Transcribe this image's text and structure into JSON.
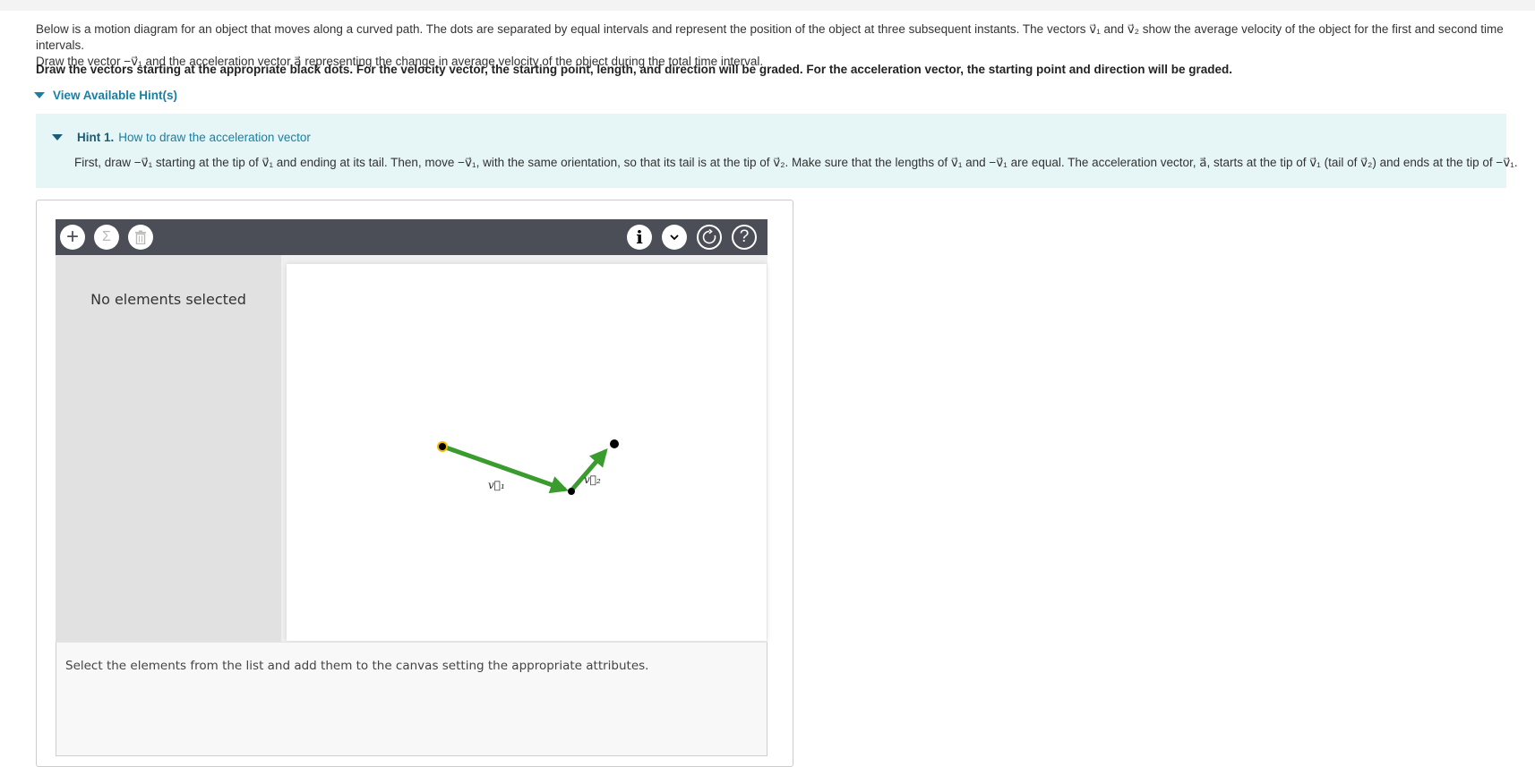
{
  "problem": {
    "text_line1": "Below is a motion diagram for an object that moves along a curved path. The dots are separated by equal intervals and represent the position of the object at three subsequent instants. The vectors v⃗₁ and v⃗₂ show the average velocity of the object for the first and second time intervals.",
    "text_line2": "Draw the vector −v⃗₁ and the acceleration vector a⃗ representing the change in average velocity of the object during the total time interval.",
    "instructions": "Draw the vectors starting at the appropriate black dots. For the velocity vector, the starting point, length, and direction will be graded. For the acceleration vector, the starting point and direction will be graded."
  },
  "hints": {
    "toggle_label": "View Available Hint(s)",
    "hint1": {
      "number": "Hint 1.",
      "title": "How to draw the acceleration vector",
      "text": "First, draw −v⃗₁ starting at the tip of v⃗₁ and ending at its tail. Then, move −v⃗₁, with the same orientation, so that its tail is at the tip of v⃗₂. Make sure that the lengths of v⃗₁ and −v⃗₁ are equal. The acceleration vector, a⃗, starts at the tip of v⃗₁ (tail of v⃗₂) and ends at the tip of −v⃗₁."
    }
  },
  "toolbar": {
    "left_icons": [
      "plus-icon",
      "sigma-icon",
      "trash-icon"
    ],
    "right_icons": [
      "info-icon",
      "chevron-down-icon",
      "reset-icon",
      "help-icon"
    ],
    "plus_glyph": "+",
    "sigma_glyph": "Σ",
    "info_glyph": "i",
    "help_glyph": "?"
  },
  "sidebar": {
    "empty_text": "No elements selected"
  },
  "canvas": {
    "v1_label": "v⃗₁",
    "v2_label": "v⃗₂",
    "vector_color": "#3a9c2f",
    "dot_color": "#000000",
    "selected_dot_ring_color": "#f5b800"
  },
  "status": {
    "text": "Select the elements from the list and add them to the canvas setting the appropriate attributes."
  }
}
